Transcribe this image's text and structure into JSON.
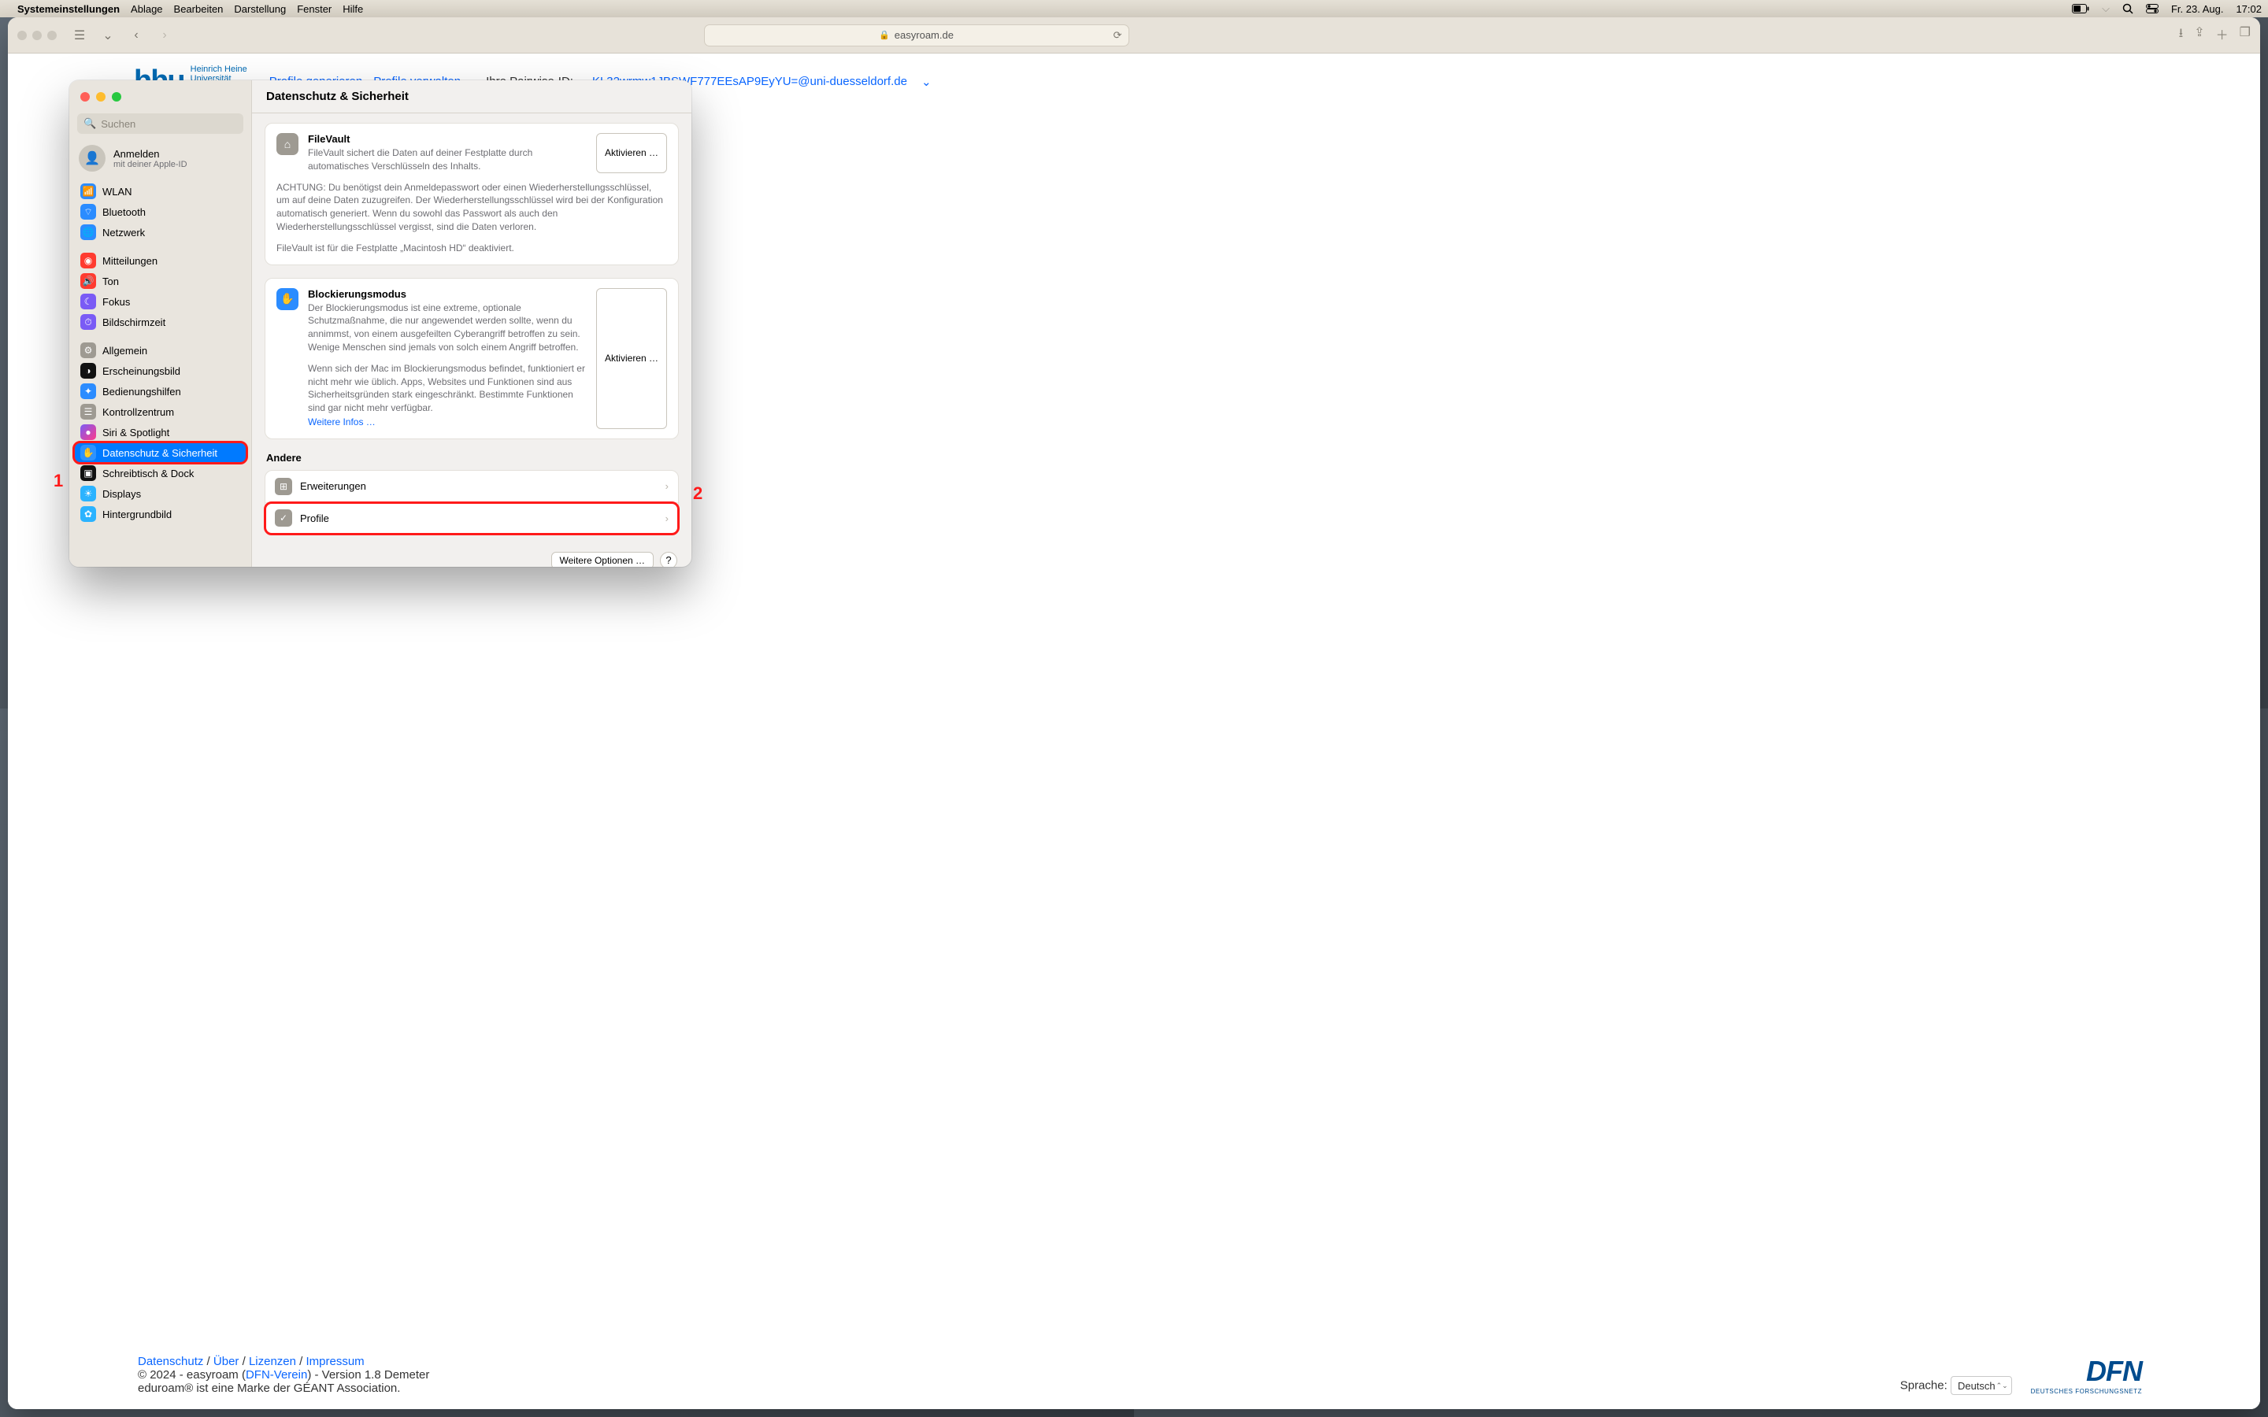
{
  "menubar": {
    "app": "Systemeinstellungen",
    "items": [
      "Ablage",
      "Bearbeiten",
      "Darstellung",
      "Fenster",
      "Hilfe"
    ],
    "date": "Fr. 23. Aug.",
    "time": "17:02"
  },
  "safari": {
    "url_host": "easyroam.de"
  },
  "page": {
    "logo_text": "hhu",
    "logo_sub1": "Heinrich Heine",
    "logo_sub2": "Universität",
    "nav": {
      "generate": "Profile generieren",
      "manage": "Profile verwalten"
    },
    "pairwise_label": "Ihre Pairwise-ID:",
    "pairwise_value": "KL32wrmw1JBSWF777EEsAP9EyYU=@uni-duesseldorf.de",
    "footer": {
      "links": {
        "ds": "Datenschutz",
        "about": "Über",
        "lic": "Lizenzen",
        "imp": "Impressum"
      },
      "copyright": "© 2024 - easyroam (",
      "dfn_link": "DFN-Verein",
      "copyright_tail": ") - Version 1.8 Demeter",
      "eduroam": "eduroam® ist eine Marke der GÉANT Association.",
      "lang_label": "Sprache:",
      "lang_value": "Deutsch",
      "dfn_logo": "DFN",
      "dfn_sub": "DEUTSCHES FORSCHUNGSNETZ"
    }
  },
  "settings": {
    "title": "Datenschutz & Sicherheit",
    "search_placeholder": "Suchen",
    "signin_title": "Anmelden",
    "signin_sub": "mit deiner Apple-ID",
    "sidebar": [
      {
        "label": "WLAN",
        "icon": "ic-wlan",
        "glyph": "📶"
      },
      {
        "label": "Bluetooth",
        "icon": "ic-bt",
        "glyph": "⌔"
      },
      {
        "label": "Netzwerk",
        "icon": "ic-net",
        "glyph": "🌐"
      },
      {
        "gap": true
      },
      {
        "label": "Mitteilungen",
        "icon": "ic-notif",
        "glyph": "◉"
      },
      {
        "label": "Ton",
        "icon": "ic-snd",
        "glyph": "🔊"
      },
      {
        "label": "Fokus",
        "icon": "ic-focus",
        "glyph": "☾"
      },
      {
        "label": "Bildschirmzeit",
        "icon": "ic-scr",
        "glyph": "⏱"
      },
      {
        "gap": true
      },
      {
        "label": "Allgemein",
        "icon": "ic-gen",
        "glyph": "⚙"
      },
      {
        "label": "Erscheinungsbild",
        "icon": "ic-appear",
        "glyph": "◑"
      },
      {
        "label": "Bedienungshilfen",
        "icon": "ic-acc",
        "glyph": "✦"
      },
      {
        "label": "Kontrollzentrum",
        "icon": "ic-cc",
        "glyph": "☰"
      },
      {
        "label": "Siri & Spotlight",
        "icon": "ic-siri",
        "glyph": "●"
      },
      {
        "label": "Datenschutz & Sicherheit",
        "icon": "ic-priv",
        "glyph": "✋",
        "selected": true,
        "highlight": true
      },
      {
        "label": "Schreibtisch & Dock",
        "icon": "ic-desk",
        "glyph": "▣"
      },
      {
        "label": "Displays",
        "icon": "ic-disp",
        "glyph": "☀"
      },
      {
        "label": "Hintergrundbild",
        "icon": "ic-wall",
        "glyph": "✿"
      }
    ],
    "filevault": {
      "title": "FileVault",
      "desc": "FileVault sichert die Daten auf deiner Festplatte durch automatisches Verschlüsseln des Inhalts.",
      "warn": "ACHTUNG: Du benötigst dein Anmeldepasswort oder einen Wiederherstellungsschlüssel, um auf deine Daten zuzugreifen. Der Wiederherstellungsschlüssel wird bei der Konfiguration automatisch generiert. Wenn du sowohl das Passwort als auch den Wiederherstellungsschlüssel vergisst, sind die Daten verloren.",
      "status": "FileVault ist für die Festplatte „Macintosh HD“ deaktiviert.",
      "button": "Aktivieren …"
    },
    "lockdown": {
      "title": "Blockierungsmodus",
      "desc": "Der Blockierungsmodus ist eine extreme, optionale Schutzmaßnahme, die nur angewendet werden sollte, wenn du annimmst, von einem ausgefeilten Cyberangriff betroffen zu sein. Wenige Menschen sind jemals von solch einem Angriff betroffen.",
      "desc2": "Wenn sich der Mac im Blockierungsmodus befindet, funktioniert er nicht mehr wie üblich. Apps, Websites und Funktionen sind aus Sicherheitsgründen stark eingeschränkt. Bestimmte Funktionen sind gar nicht mehr verfügbar.",
      "more": "Weitere Infos …",
      "button": "Aktivieren …"
    },
    "other": {
      "title": "Andere",
      "extensions": "Erweiterungen",
      "profiles": "Profile"
    },
    "footer": {
      "more_options": "Weitere Optionen …"
    }
  },
  "annotations": {
    "one": "1",
    "two": "2"
  }
}
